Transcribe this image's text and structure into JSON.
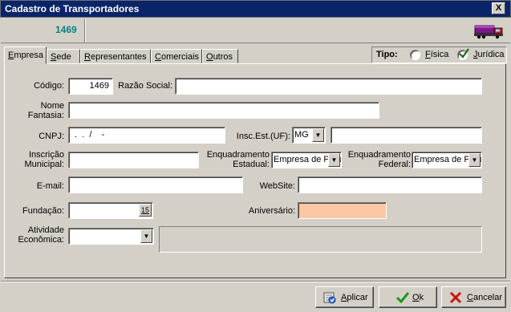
{
  "window": {
    "title": "Cadastro de Transportadores",
    "close_label": "X"
  },
  "header": {
    "record_id": "1469"
  },
  "tabs": [
    {
      "accel": "E",
      "rest": "mpresa"
    },
    {
      "accel": "S",
      "rest": "ede"
    },
    {
      "accel": "R",
      "rest": "epresentantes"
    },
    {
      "accel": "C",
      "rest": "omerciais"
    },
    {
      "accel": "O",
      "rest": "utros"
    }
  ],
  "tipo": {
    "label": "Tipo:",
    "fisica": {
      "accel": "F",
      "rest": "ísica",
      "checked": false
    },
    "juridica": {
      "accel": "J",
      "rest": "urídica",
      "checked": true
    }
  },
  "form": {
    "codigo": {
      "label": "Código:",
      "value": "1469"
    },
    "razao_social": {
      "label": "Razão Social:",
      "value": ""
    },
    "nome_fantasia": {
      "label_line1": "Nome",
      "label_line2": "Fantasia:",
      "value": ""
    },
    "cnpj": {
      "label": "CNPJ:",
      "value": " .  .  /    -"
    },
    "insc_est": {
      "label": "Insc.Est.(UF):",
      "uf_value": "MG",
      "value": ""
    },
    "insc_municipal": {
      "label_line1": "Inscrição",
      "label_line2": "Municipal:",
      "value": ""
    },
    "enq_estadual": {
      "label_line1": "Enquadramento",
      "label_line2": "Estadual:",
      "value": "Empresa de Pequeno Porte"
    },
    "enq_federal": {
      "label_line1": "Enquadramento",
      "label_line2": "Federal:",
      "value": "Empresa de Pequeno Porte"
    },
    "email": {
      "label": "E-mail:",
      "value": ""
    },
    "website": {
      "label": "WebSite:",
      "value": ""
    },
    "fundacao": {
      "label": "Fundação:",
      "value": "",
      "calendar_label": "15"
    },
    "aniversario": {
      "label": "Aniversário:",
      "value": "",
      "bg_color": "#fcc8a4"
    },
    "atividade": {
      "label_line1": "Atividade",
      "label_line2": "Econômica:",
      "value": ""
    }
  },
  "buttons": {
    "aplicar": {
      "accel": "A",
      "rest": "plicar"
    },
    "ok": {
      "accel": "O",
      "rest": "k"
    },
    "cancelar": {
      "accel": "C",
      "rest": "ancelar"
    }
  },
  "colors": {
    "title_bg": "#0a246a",
    "id_color": "#0e8080",
    "ok_green": "#1a9a1a",
    "cancel_red": "#cc1010"
  }
}
